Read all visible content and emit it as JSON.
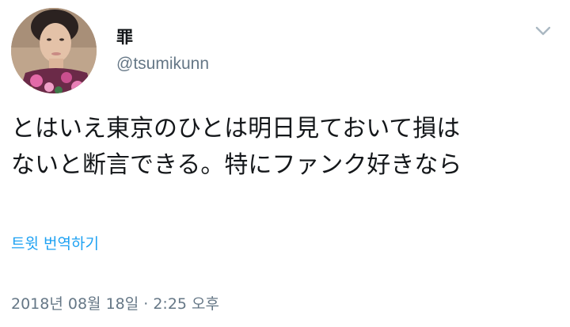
{
  "tweet": {
    "author": {
      "display_name": "罪",
      "handle": "@tsumikunn",
      "avatar_icon": "profile-photo"
    },
    "menu_icon": "chevron-down-icon",
    "text_lines": [
      "とはいえ東京のひとは明日見ておいて損は",
      "ないと断言できる。特にファンク好きなら"
    ],
    "translate_label": "트윗 번역하기",
    "timestamp": "2018년 08월 18일 · 2:25 오후"
  },
  "colors": {
    "text": "#14171a",
    "secondary": "#657786",
    "link": "#1da1f2",
    "chevron": "#aab8c2"
  }
}
